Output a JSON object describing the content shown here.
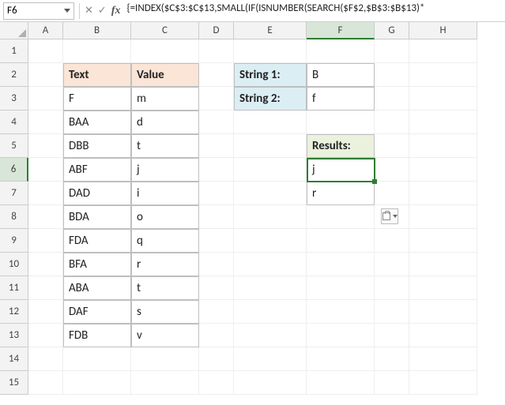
{
  "cellRef": "F6",
  "formula": "{=INDEX($C$3:$C$13,SMALL(IF(ISNUMBER(SEARCH($F$2,$B$3:$B$13)*",
  "cols": [
    "A",
    "B",
    "C",
    "D",
    "E",
    "F",
    "G",
    "H"
  ],
  "rows": [
    "1",
    "2",
    "3",
    "4",
    "5",
    "6",
    "7",
    "8",
    "9",
    "10",
    "11",
    "12",
    "13",
    "14",
    "15"
  ],
  "table1": {
    "headers": {
      "text": "Text",
      "value": "Value"
    },
    "rows": [
      {
        "text": "F",
        "value": "m"
      },
      {
        "text": "BAA",
        "value": "d"
      },
      {
        "text": "DBB",
        "value": "t"
      },
      {
        "text": "ABF",
        "value": "j"
      },
      {
        "text": "DAD",
        "value": "i"
      },
      {
        "text": "BDA",
        "value": "o"
      },
      {
        "text": "FDA",
        "value": "q"
      },
      {
        "text": "BFA",
        "value": "r"
      },
      {
        "text": "ABA",
        "value": "t"
      },
      {
        "text": "DAF",
        "value": "s"
      },
      {
        "text": "FDB",
        "value": "v"
      }
    ]
  },
  "strings": {
    "label1": "String 1:",
    "val1": "B",
    "label2": "String 2:",
    "val2": "f"
  },
  "results": {
    "header": "Results:",
    "vals": [
      "j",
      "r"
    ]
  },
  "activeCell": "F6",
  "selectedCol": "F",
  "selectedRow": "6"
}
